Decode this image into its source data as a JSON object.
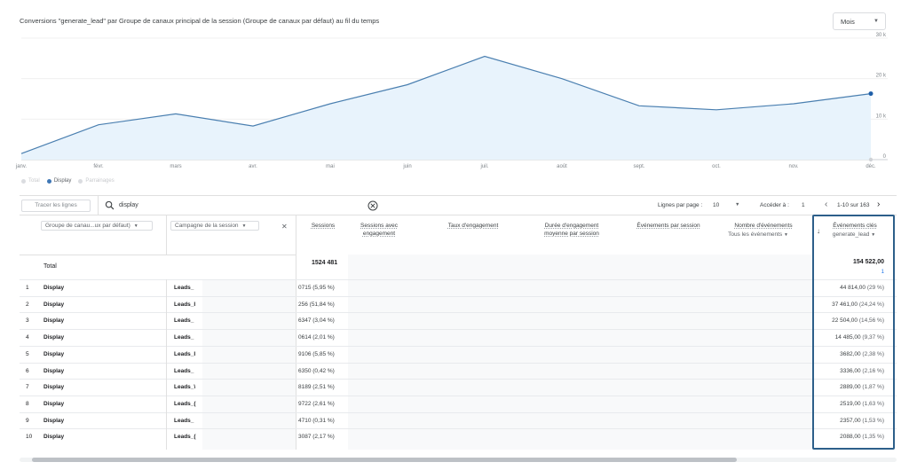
{
  "chart_title": "Conversions \"generate_lead\" par Groupe de canaux principal de la session (Groupe de canaux par défaut) au fil du temps",
  "period_select": "Mois",
  "chart_data": {
    "type": "area",
    "x": [
      "janv.",
      "févr.",
      "mars",
      "avr.",
      "mai",
      "juin",
      "juil.",
      "août",
      "sept.",
      "oct.",
      "nov.",
      "déc."
    ],
    "series": [
      {
        "name": "Display",
        "values": [
          1500,
          8600,
          11300,
          8300,
          13800,
          18500,
          25500,
          20000,
          13300,
          12300,
          13800,
          16300
        ]
      }
    ],
    "y_ticks": [
      "30 k",
      "20 k",
      "10 k",
      "0"
    ],
    "ylim": [
      0,
      30000
    ],
    "grid": true,
    "colors": {
      "line": "#4a7fb0",
      "fill": "#e8f3fc"
    }
  },
  "legend": [
    {
      "label": "Total",
      "color": "#dadce0",
      "active": false
    },
    {
      "label": "Display",
      "color": "#3f77b5",
      "active": true
    },
    {
      "label": "Parrainages",
      "color": "#dadce0",
      "active": false
    }
  ],
  "toolbar": {
    "trace_button": "Tracer les lignes",
    "search_value": "display",
    "rows_label": "Lignes par page :",
    "rows_value": "10",
    "goto_label": "Accéder à :",
    "goto_value": "1",
    "page_range": "1-10 sur 163"
  },
  "table": {
    "dim1_select": "Groupe de canau...ux par défaut)",
    "dim2_select": "Campagne de la session",
    "columns": {
      "sessions": "Sessions",
      "engaged_1": "Sessions avec",
      "engaged_2": "engagement",
      "engagement_rate": "Taux d'engagement",
      "duration_1": "Durée d'engagement",
      "duration_2": "moyenne par session",
      "events_per_session": "Événements par session",
      "event_count": "Nombre d'événements",
      "event_count_sub": "Tous les événements",
      "key_events": "Événements clés",
      "key_events_sub": "generate_lead"
    },
    "total_label": "Total",
    "total_sessions": "1524 481",
    "total_events": "154 522,00",
    "total_events_pct": "1",
    "rows": [
      {
        "idx": "1",
        "channel": "Display",
        "campaign": "Leads_",
        "sessions": "0715 (5,95 %)",
        "events": "44 814,00",
        "pct": "(29 %)"
      },
      {
        "idx": "2",
        "channel": "Display",
        "campaign": "Leads_I",
        "sessions": "256 (51,84 %)",
        "events": "37 461,00",
        "pct": "(24,24 %)"
      },
      {
        "idx": "3",
        "channel": "Display",
        "campaign": "Leads_",
        "sessions": "6347 (3,04 %)",
        "events": "22 504,00",
        "pct": "(14,56 %)"
      },
      {
        "idx": "4",
        "channel": "Display",
        "campaign": "Leads_",
        "sessions": "0614 (2,01 %)",
        "events": "14 485,00",
        "pct": "(9,37 %)"
      },
      {
        "idx": "5",
        "channel": "Display",
        "campaign": "Leads_I",
        "sessions": "9106 (5,85 %)",
        "events": "3682,00",
        "pct": "(2,38 %)"
      },
      {
        "idx": "6",
        "channel": "Display",
        "campaign": "Leads_",
        "sessions": "6350 (0,42 %)",
        "events": "3336,00",
        "pct": "(2,16 %)"
      },
      {
        "idx": "7",
        "channel": "Display",
        "campaign": "Leads_\\",
        "sessions": "8189 (2,51 %)",
        "events": "2889,00",
        "pct": "(1,87 %)"
      },
      {
        "idx": "8",
        "channel": "Display",
        "campaign": "Leads_(",
        "sessions": "9722 (2,61 %)",
        "events": "2519,00",
        "pct": "(1,63 %)"
      },
      {
        "idx": "9",
        "channel": "Display",
        "campaign": "Leads_",
        "sessions": "4710 (0,31 %)",
        "events": "2357,00",
        "pct": "(1,53 %)"
      },
      {
        "idx": "10",
        "channel": "Display",
        "campaign": "Leads_(",
        "sessions": "3087 (2,17 %)",
        "events": "2088,00",
        "pct": "(1,35 %)"
      }
    ]
  },
  "accent_color": "#2d5f8a"
}
